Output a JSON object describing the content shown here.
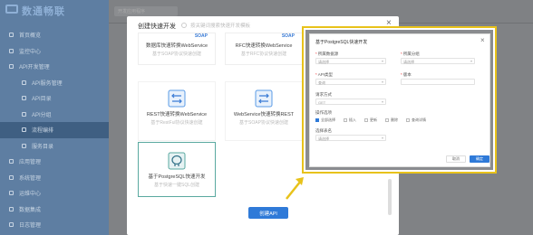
{
  "app": {
    "logo_text": "数通畅联",
    "tab_label": "开发应用程序"
  },
  "sidebar": {
    "items": [
      {
        "label": "首页概览",
        "sub": false
      },
      {
        "label": "监控中心",
        "sub": false
      },
      {
        "label": "API开发管理",
        "sub": false
      },
      {
        "label": "API服务管理",
        "sub": true
      },
      {
        "label": "API目录",
        "sub": true
      },
      {
        "label": "API分组",
        "sub": true
      },
      {
        "label": "流程编排",
        "sub": true
      },
      {
        "label": "服务目录",
        "sub": true
      },
      {
        "label": "应用管理",
        "sub": false
      },
      {
        "label": "系统管理",
        "sub": false
      },
      {
        "label": "运维中心",
        "sub": false
      },
      {
        "label": "数据集成",
        "sub": false
      },
      {
        "label": "日志管理",
        "sub": false
      }
    ],
    "active_index": 6
  },
  "modal": {
    "title": "创建快速开发",
    "search_placeholder": "按关键词搜索快速开发模板",
    "close_icon": "close-icon",
    "cards": [
      {
        "tag": "SOAP",
        "title": "数据库快速转换WebService",
        "sub": "基于SOAP协议快速创建"
      },
      {
        "tag": "SOAP",
        "title": "RFC快速转换WebService",
        "sub": "基于RFC协议快速创建"
      },
      {
        "tag": "",
        "title": "REST快速转换WebService",
        "sub": "基于RestFul协议快速创建"
      },
      {
        "tag": "",
        "title": "WebService快速转换REST",
        "sub": "基于SOAP协议快速创建"
      },
      {
        "tag": "",
        "title": "基于PostgreSQL快速开发",
        "sub": "基于快速一键SQL创建"
      }
    ],
    "build_button": "创建API"
  },
  "panel": {
    "title": "基于PostgreSQL快速开发",
    "fields": {
      "datasource_label": "所属数据源",
      "datasource_placeholder": "请选择",
      "group_label": "所属分组",
      "group_placeholder": "请选择",
      "type_label": "API类型",
      "type_value": "查询",
      "version_label": "版本",
      "version_value": "",
      "method_label": "请求方式",
      "method_value": "GET",
      "ops_label": "操作选项",
      "table_label": "选择表名",
      "table_placeholder": "请选择"
    },
    "checkboxes": [
      {
        "label": "全部选择",
        "checked": true
      },
      {
        "label": "插入",
        "checked": false
      },
      {
        "label": "更新",
        "checked": false
      },
      {
        "label": "删除",
        "checked": false
      },
      {
        "label": "查询详情",
        "checked": false
      }
    ],
    "cancel_button": "取消",
    "confirm_button": "确定"
  },
  "colors": {
    "highlight": "#e8c21a",
    "primary": "#2f7ad8",
    "selected_card": "#5aa9a0"
  }
}
